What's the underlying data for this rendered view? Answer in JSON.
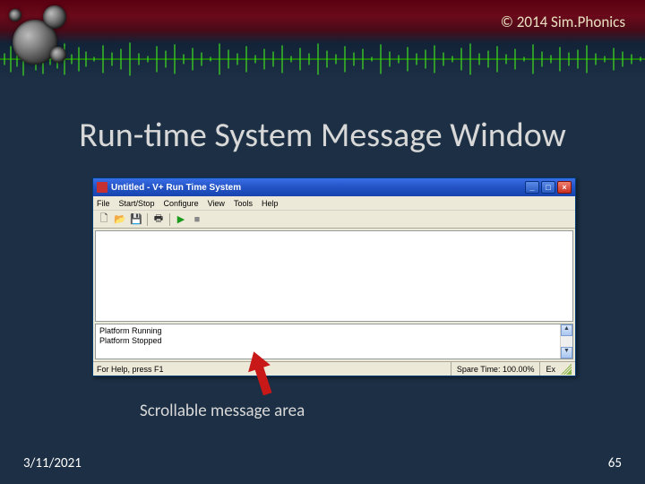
{
  "copyright": "© 2014 Sim.Phonics",
  "title": "Run-time System Message Window",
  "window": {
    "title": "Untitled - V+ Run Time System",
    "menus": [
      "File",
      "Start/Stop",
      "Configure",
      "View",
      "Tools",
      "Help"
    ],
    "messages": "Platform Running\nPlatform Stopped",
    "status_help": "For Help, press F1",
    "status_spare": "Spare Time: 100.00%",
    "status_ex": "Ex"
  },
  "caption": "Scrollable message area",
  "footer": {
    "date": "3/11/2021",
    "page": "65"
  }
}
